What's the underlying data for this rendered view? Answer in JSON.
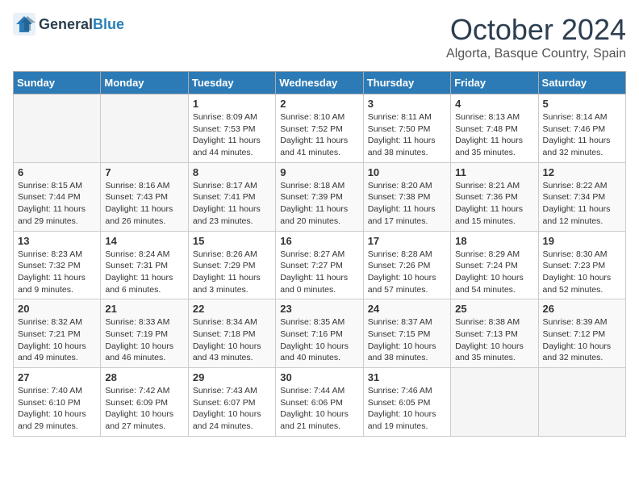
{
  "header": {
    "logo_general": "General",
    "logo_blue": "Blue",
    "month": "October 2024",
    "location": "Algorta, Basque Country, Spain"
  },
  "weekdays": [
    "Sunday",
    "Monday",
    "Tuesday",
    "Wednesday",
    "Thursday",
    "Friday",
    "Saturday"
  ],
  "weeks": [
    [
      {
        "day": "",
        "empty": true
      },
      {
        "day": "",
        "empty": true
      },
      {
        "day": "1",
        "sunrise": "Sunrise: 8:09 AM",
        "sunset": "Sunset: 7:53 PM",
        "daylight": "Daylight: 11 hours and 44 minutes."
      },
      {
        "day": "2",
        "sunrise": "Sunrise: 8:10 AM",
        "sunset": "Sunset: 7:52 PM",
        "daylight": "Daylight: 11 hours and 41 minutes."
      },
      {
        "day": "3",
        "sunrise": "Sunrise: 8:11 AM",
        "sunset": "Sunset: 7:50 PM",
        "daylight": "Daylight: 11 hours and 38 minutes."
      },
      {
        "day": "4",
        "sunrise": "Sunrise: 8:13 AM",
        "sunset": "Sunset: 7:48 PM",
        "daylight": "Daylight: 11 hours and 35 minutes."
      },
      {
        "day": "5",
        "sunrise": "Sunrise: 8:14 AM",
        "sunset": "Sunset: 7:46 PM",
        "daylight": "Daylight: 11 hours and 32 minutes."
      }
    ],
    [
      {
        "day": "6",
        "sunrise": "Sunrise: 8:15 AM",
        "sunset": "Sunset: 7:44 PM",
        "daylight": "Daylight: 11 hours and 29 minutes."
      },
      {
        "day": "7",
        "sunrise": "Sunrise: 8:16 AM",
        "sunset": "Sunset: 7:43 PM",
        "daylight": "Daylight: 11 hours and 26 minutes."
      },
      {
        "day": "8",
        "sunrise": "Sunrise: 8:17 AM",
        "sunset": "Sunset: 7:41 PM",
        "daylight": "Daylight: 11 hours and 23 minutes."
      },
      {
        "day": "9",
        "sunrise": "Sunrise: 8:18 AM",
        "sunset": "Sunset: 7:39 PM",
        "daylight": "Daylight: 11 hours and 20 minutes."
      },
      {
        "day": "10",
        "sunrise": "Sunrise: 8:20 AM",
        "sunset": "Sunset: 7:38 PM",
        "daylight": "Daylight: 11 hours and 17 minutes."
      },
      {
        "day": "11",
        "sunrise": "Sunrise: 8:21 AM",
        "sunset": "Sunset: 7:36 PM",
        "daylight": "Daylight: 11 hours and 15 minutes."
      },
      {
        "day": "12",
        "sunrise": "Sunrise: 8:22 AM",
        "sunset": "Sunset: 7:34 PM",
        "daylight": "Daylight: 11 hours and 12 minutes."
      }
    ],
    [
      {
        "day": "13",
        "sunrise": "Sunrise: 8:23 AM",
        "sunset": "Sunset: 7:32 PM",
        "daylight": "Daylight: 11 hours and 9 minutes."
      },
      {
        "day": "14",
        "sunrise": "Sunrise: 8:24 AM",
        "sunset": "Sunset: 7:31 PM",
        "daylight": "Daylight: 11 hours and 6 minutes."
      },
      {
        "day": "15",
        "sunrise": "Sunrise: 8:26 AM",
        "sunset": "Sunset: 7:29 PM",
        "daylight": "Daylight: 11 hours and 3 minutes."
      },
      {
        "day": "16",
        "sunrise": "Sunrise: 8:27 AM",
        "sunset": "Sunset: 7:27 PM",
        "daylight": "Daylight: 11 hours and 0 minutes."
      },
      {
        "day": "17",
        "sunrise": "Sunrise: 8:28 AM",
        "sunset": "Sunset: 7:26 PM",
        "daylight": "Daylight: 10 hours and 57 minutes."
      },
      {
        "day": "18",
        "sunrise": "Sunrise: 8:29 AM",
        "sunset": "Sunset: 7:24 PM",
        "daylight": "Daylight: 10 hours and 54 minutes."
      },
      {
        "day": "19",
        "sunrise": "Sunrise: 8:30 AM",
        "sunset": "Sunset: 7:23 PM",
        "daylight": "Daylight: 10 hours and 52 minutes."
      }
    ],
    [
      {
        "day": "20",
        "sunrise": "Sunrise: 8:32 AM",
        "sunset": "Sunset: 7:21 PM",
        "daylight": "Daylight: 10 hours and 49 minutes."
      },
      {
        "day": "21",
        "sunrise": "Sunrise: 8:33 AM",
        "sunset": "Sunset: 7:19 PM",
        "daylight": "Daylight: 10 hours and 46 minutes."
      },
      {
        "day": "22",
        "sunrise": "Sunrise: 8:34 AM",
        "sunset": "Sunset: 7:18 PM",
        "daylight": "Daylight: 10 hours and 43 minutes."
      },
      {
        "day": "23",
        "sunrise": "Sunrise: 8:35 AM",
        "sunset": "Sunset: 7:16 PM",
        "daylight": "Daylight: 10 hours and 40 minutes."
      },
      {
        "day": "24",
        "sunrise": "Sunrise: 8:37 AM",
        "sunset": "Sunset: 7:15 PM",
        "daylight": "Daylight: 10 hours and 38 minutes."
      },
      {
        "day": "25",
        "sunrise": "Sunrise: 8:38 AM",
        "sunset": "Sunset: 7:13 PM",
        "daylight": "Daylight: 10 hours and 35 minutes."
      },
      {
        "day": "26",
        "sunrise": "Sunrise: 8:39 AM",
        "sunset": "Sunset: 7:12 PM",
        "daylight": "Daylight: 10 hours and 32 minutes."
      }
    ],
    [
      {
        "day": "27",
        "sunrise": "Sunrise: 7:40 AM",
        "sunset": "Sunset: 6:10 PM",
        "daylight": "Daylight: 10 hours and 29 minutes."
      },
      {
        "day": "28",
        "sunrise": "Sunrise: 7:42 AM",
        "sunset": "Sunset: 6:09 PM",
        "daylight": "Daylight: 10 hours and 27 minutes."
      },
      {
        "day": "29",
        "sunrise": "Sunrise: 7:43 AM",
        "sunset": "Sunset: 6:07 PM",
        "daylight": "Daylight: 10 hours and 24 minutes."
      },
      {
        "day": "30",
        "sunrise": "Sunrise: 7:44 AM",
        "sunset": "Sunset: 6:06 PM",
        "daylight": "Daylight: 10 hours and 21 minutes."
      },
      {
        "day": "31",
        "sunrise": "Sunrise: 7:46 AM",
        "sunset": "Sunset: 6:05 PM",
        "daylight": "Daylight: 10 hours and 19 minutes."
      },
      {
        "day": "",
        "empty": true
      },
      {
        "day": "",
        "empty": true
      }
    ]
  ]
}
